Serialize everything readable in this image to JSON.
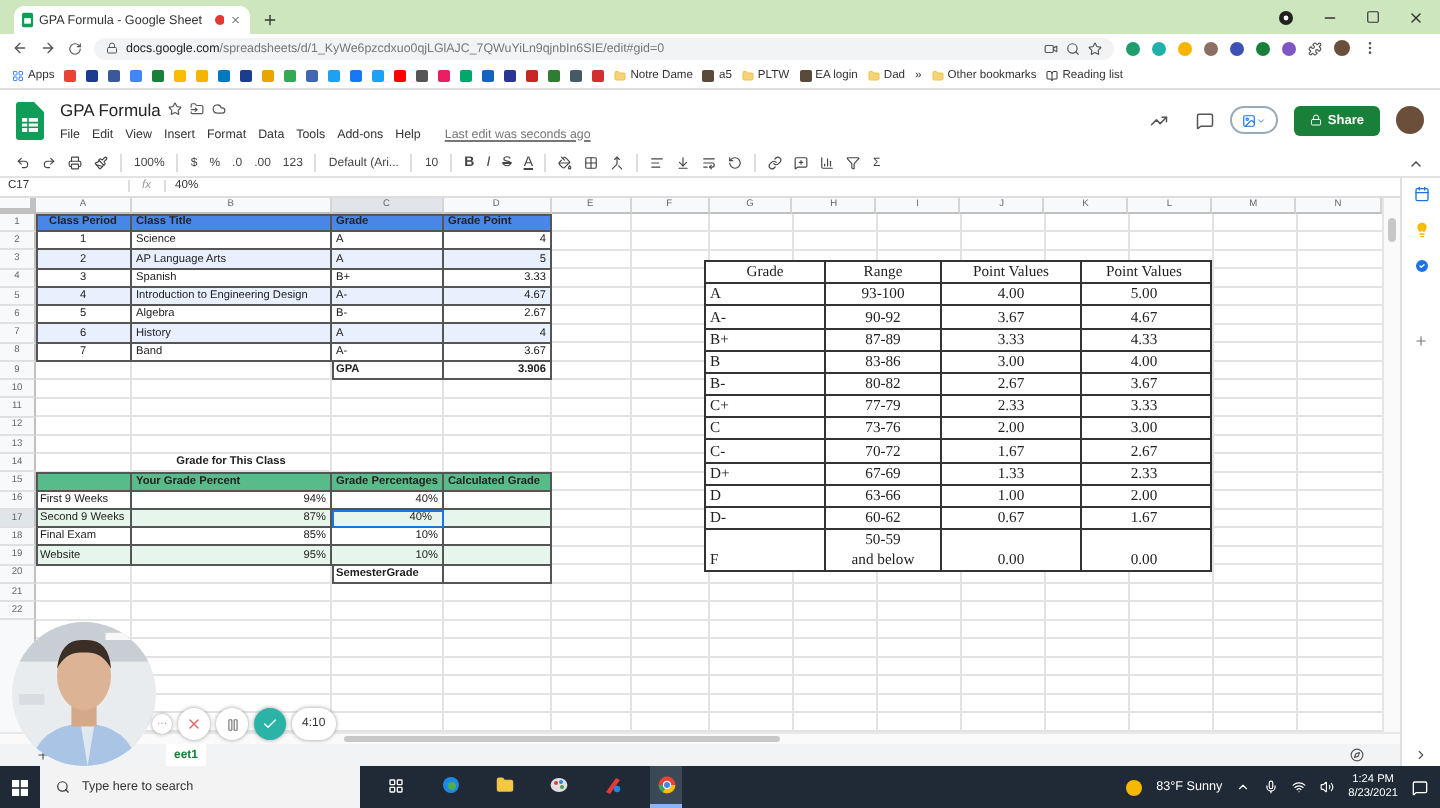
{
  "browser": {
    "tab_title": "GPA Formula - Google Sheet",
    "url_host": "docs.google.com",
    "url_path": "/spreadsheets/d/1_KyWe6pzcdxuo0qjLGlAJC_7QWuYiLn9qjnbIn6SIE/edit#gid=0",
    "bookmarks": [
      {
        "kind": "apps",
        "label": "Apps"
      },
      {
        "kind": "folder",
        "label": "Notre Dame"
      },
      {
        "kind": "site",
        "label": "a5"
      },
      {
        "kind": "folder",
        "label": "PLTW"
      },
      {
        "kind": "site",
        "label": "EA login"
      },
      {
        "kind": "folder",
        "label": "Dad"
      }
    ],
    "overflow": "»",
    "other_bookmarks": "Other bookmarks",
    "reading_list": "Reading list"
  },
  "doc": {
    "title": "GPA Formula",
    "menus": [
      "File",
      "Edit",
      "View",
      "Insert",
      "Format",
      "Data",
      "Tools",
      "Add-ons",
      "Help"
    ],
    "last_edit": "Last edit was seconds ago",
    "share": "Share"
  },
  "toolbar": {
    "zoom": "100%",
    "currency": "$",
    "percent": "%",
    "decrease_decimals": ".0",
    "increase_decimals": ".00",
    "number_format": "123",
    "font": "Default (Ari...",
    "font_size": "10",
    "bold": "B",
    "italic": "I",
    "strike": "S",
    "text_color": "A",
    "functions": "Σ"
  },
  "formula_bar": {
    "cell": "C17",
    "fx": "fx",
    "value": "40%"
  },
  "grid": {
    "columns": [
      "A",
      "B",
      "C",
      "D",
      "E",
      "F",
      "G",
      "H",
      "I",
      "J",
      "K",
      "L",
      "M",
      "N"
    ],
    "rows": [
      {
        "number": "1",
        "kind": "class-header",
        "cells": [
          {
            "text": "Class Period",
            "selected": false
          },
          {
            "text": "Class Title",
            "selected": false
          },
          {
            "text": "Grade",
            "selected": false
          },
          {
            "text": "Grade Point",
            "selected": false
          }
        ]
      },
      {
        "number": "2",
        "kind": "class-row",
        "cells": [
          {
            "text": "1",
            "selected": false
          },
          {
            "text": "Science",
            "selected": false
          },
          {
            "text": "A",
            "selected": false
          },
          {
            "text": "4",
            "selected": false
          }
        ]
      },
      {
        "number": "3",
        "kind": "class-band",
        "cells": [
          {
            "text": "2",
            "selected": false
          },
          {
            "text": "AP Language Arts",
            "selected": false
          },
          {
            "text": "A",
            "selected": false
          },
          {
            "text": "5",
            "selected": false
          }
        ]
      },
      {
        "number": "4",
        "kind": "class-row",
        "cells": [
          {
            "text": "3",
            "selected": false
          },
          {
            "text": "Spanish",
            "selected": false
          },
          {
            "text": "B+",
            "selected": false
          },
          {
            "text": "3.33",
            "selected": false
          }
        ]
      },
      {
        "number": "5",
        "kind": "class-band",
        "cells": [
          {
            "text": "4",
            "selected": false
          },
          {
            "text": "Introduction to Engineering Design",
            "selected": false
          },
          {
            "text": "A-",
            "selected": false
          },
          {
            "text": "4.67",
            "selected": false
          }
        ]
      },
      {
        "number": "6",
        "kind": "class-row",
        "cells": [
          {
            "text": "5",
            "selected": false
          },
          {
            "text": "Algebra",
            "selected": false
          },
          {
            "text": "B-",
            "selected": false
          },
          {
            "text": "2.67",
            "selected": false
          }
        ]
      },
      {
        "number": "7",
        "kind": "class-band",
        "cells": [
          {
            "text": "6",
            "selected": false
          },
          {
            "text": "History",
            "selected": false
          },
          {
            "text": "A",
            "selected": false
          },
          {
            "text": "4",
            "selected": false
          }
        ]
      },
      {
        "number": "8",
        "kind": "class-row",
        "cells": [
          {
            "text": "7",
            "selected": false
          },
          {
            "text": "Band",
            "selected": false
          },
          {
            "text": "A-",
            "selected": false
          },
          {
            "text": "3.67",
            "selected": false
          }
        ]
      },
      {
        "number": "9",
        "kind": "class-total",
        "cells": [
          null,
          null,
          {
            "text": "GPA",
            "selected": false
          },
          {
            "text": "3.906",
            "selected": false
          }
        ]
      },
      {
        "number": "10",
        "kind": "blank"
      },
      {
        "number": "11",
        "kind": "blank"
      },
      {
        "number": "12",
        "kind": "blank"
      },
      {
        "number": "13",
        "kind": "blank"
      },
      {
        "number": "14",
        "kind": "grade-title",
        "cells": [
          null,
          {
            "text": "Grade for This Class",
            "selected": false
          }
        ]
      },
      {
        "number": "15",
        "kind": "grade-header",
        "cells": [
          null,
          {
            "text": "Your Grade Percent",
            "selected": false
          },
          {
            "text": "Grade Percentages",
            "selected": false
          },
          {
            "text": "Calculated Grade",
            "selected": false
          }
        ]
      },
      {
        "number": "16",
        "kind": "grade-row",
        "cells": [
          {
            "text": "First 9 Weeks",
            "selected": false
          },
          {
            "text": "94%",
            "selected": false
          },
          {
            "text": "40%",
            "selected": false
          }
        ]
      },
      {
        "number": "17",
        "kind": "grade-band",
        "cells": [
          {
            "text": "Second 9 Weeks",
            "selected": false
          },
          {
            "text": "87%",
            "selected": false
          },
          {
            "text": "40%",
            "selected": true
          }
        ]
      },
      {
        "number": "18",
        "kind": "grade-row",
        "cells": [
          {
            "text": "Final Exam",
            "selected": false
          },
          {
            "text": "85%",
            "selected": false
          },
          {
            "text": "10%",
            "selected": false
          }
        ]
      },
      {
        "number": "19",
        "kind": "grade-band",
        "cells": [
          {
            "text": "Website",
            "selected": false
          },
          {
            "text": "95%",
            "selected": false
          },
          {
            "text": "10%",
            "selected": false
          }
        ]
      },
      {
        "number": "20",
        "kind": "grade-total",
        "cells": [
          null,
          null,
          {
            "text": "SemesterGrade",
            "selected": false
          }
        ]
      },
      {
        "number": "21",
        "kind": "blank"
      },
      {
        "number": "22",
        "kind": "blank"
      }
    ]
  },
  "grade_scale": {
    "header": [
      "Grade",
      "Range",
      "Point Values",
      "Point Values"
    ],
    "rows": [
      [
        "A",
        "93-100",
        "4.00",
        "5.00"
      ],
      [
        "A-",
        "90-92",
        "3.67",
        "4.67"
      ],
      [
        "B+",
        "87-89",
        "3.33",
        "4.33"
      ],
      [
        "B",
        "83-86",
        "3.00",
        "4.00"
      ],
      [
        "B-",
        "80-82",
        "2.67",
        "3.67"
      ],
      [
        "C+",
        "77-79",
        "2.33",
        "3.33"
      ],
      [
        "C",
        "73-76",
        "2.00",
        "3.00"
      ],
      [
        "C-",
        "70-72",
        "1.67",
        "2.67"
      ],
      [
        "D+",
        "67-69",
        "1.33",
        "2.33"
      ],
      [
        "D",
        "63-66",
        "1.00",
        "2.00"
      ],
      [
        "D-",
        "60-62",
        "0.67",
        "1.67"
      ],
      [
        "F",
        "50-59\nand below",
        "0.00",
        "0.00"
      ]
    ]
  },
  "sheet_tab": {
    "label": "eet1"
  },
  "recorder": {
    "more": "···",
    "time": "4:10"
  },
  "taskbar": {
    "search_placeholder": "Type here to search",
    "weather": "83°F  Sunny",
    "time": "1:24 PM",
    "date": "8/23/2021"
  }
}
